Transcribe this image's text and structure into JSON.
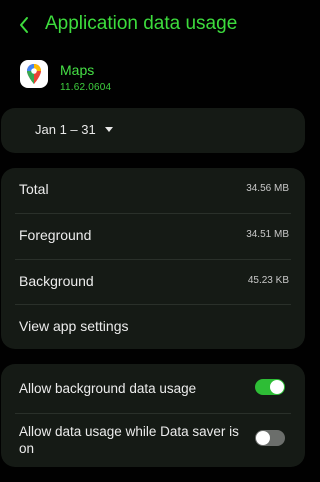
{
  "header": {
    "title": "Application data usage"
  },
  "app": {
    "name": "Maps",
    "version": "11.62.0604"
  },
  "date_range": {
    "label": "Jan 1 – 31"
  },
  "usage": {
    "rows": [
      {
        "label": "Total",
        "value": "34.56 MB"
      },
      {
        "label": "Foreground",
        "value": "34.51 MB"
      },
      {
        "label": "Background",
        "value": "45.23 KB"
      }
    ],
    "view_settings_label": "View app settings"
  },
  "settings": {
    "allow_background": {
      "label": "Allow background data usage",
      "enabled": true
    },
    "allow_data_saver": {
      "label": "Allow data usage while Data saver is on",
      "enabled": false
    }
  },
  "colors": {
    "accent": "#3ddc3d",
    "card": "#151a15",
    "switch_on": "#2ebd36",
    "switch_off": "#6b6e6b"
  }
}
